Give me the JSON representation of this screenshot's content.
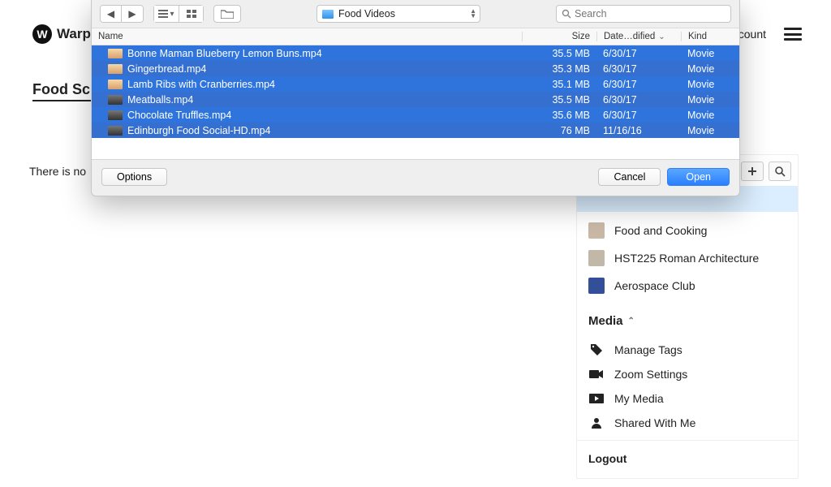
{
  "brand": {
    "initial": "W",
    "name": "Warp"
  },
  "header": {
    "account": "Account"
  },
  "page": {
    "title": "Food Sch",
    "empty_partial": "There is no"
  },
  "dialog": {
    "folder": "Food Videos",
    "search_placeholder": "Search",
    "columns": {
      "name": "Name",
      "size": "Size",
      "date": "Date…dified",
      "kind": "Kind"
    },
    "options": "Options",
    "cancel": "Cancel",
    "open": "Open",
    "files": [
      {
        "name": "Bonne Maman Blueberry Lemon Buns.mp4",
        "size": "35.5 MB",
        "date": "6/30/17",
        "kind": "Movie"
      },
      {
        "name": "Gingerbread.mp4",
        "size": "35.3 MB",
        "date": "6/30/17",
        "kind": "Movie"
      },
      {
        "name": "Lamb Ribs with Cranberries.mp4",
        "size": "35.1 MB",
        "date": "6/30/17",
        "kind": "Movie"
      },
      {
        "name": "Meatballs.mp4",
        "size": "35.5 MB",
        "date": "6/30/17",
        "kind": "Movie"
      },
      {
        "name": "Chocolate Truffles.mp4",
        "size": "35.6 MB",
        "date": "6/30/17",
        "kind": "Movie"
      },
      {
        "name": "Edinburgh Food Social-HD.mp4",
        "size": "76 MB",
        "date": "11/16/16",
        "kind": "Movie"
      }
    ]
  },
  "sidebar": {
    "channels": [
      {
        "label": "Food and Cooking"
      },
      {
        "label": "HST225 Roman Architecture"
      },
      {
        "label": "Aerospace Club"
      }
    ],
    "media_title": "Media",
    "media": [
      {
        "label": "Manage Tags"
      },
      {
        "label": "Zoom Settings"
      },
      {
        "label": "My Media"
      },
      {
        "label": "Shared With Me"
      }
    ],
    "logout": "Logout"
  }
}
